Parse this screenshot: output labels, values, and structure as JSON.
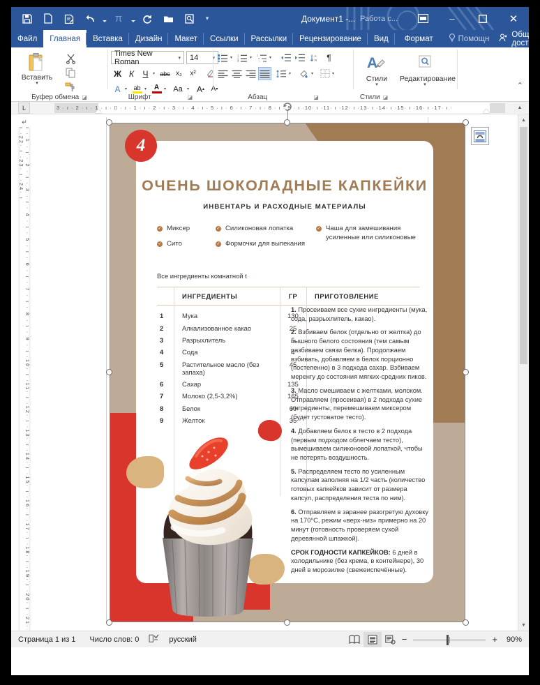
{
  "titlebar": {
    "document_title": "Документ1 -...",
    "context_title": "Работа с...",
    "quick_access": [
      {
        "name": "save-icon",
        "label": "Сохранить"
      },
      {
        "name": "new-document-icon",
        "label": "Создать"
      },
      {
        "name": "quick-print-icon",
        "label": "Быстрая печать"
      },
      {
        "name": "undo-icon",
        "label": "Отменить"
      },
      {
        "name": "equation-icon",
        "label": "Формула"
      },
      {
        "name": "redo-icon",
        "label": "Вернуть"
      },
      {
        "name": "open-icon",
        "label": "Открыть"
      },
      {
        "name": "print-preview-icon",
        "label": "Предварительный просмотр"
      }
    ],
    "customize_label": "⌄",
    "ribbon_display_label": "⊞",
    "minimize_label": "–",
    "maximize_label": "❐",
    "close_label": "✕"
  },
  "tabs": [
    {
      "label": "Файл",
      "active": false
    },
    {
      "label": "Главная",
      "active": true
    },
    {
      "label": "Вставка",
      "active": false
    },
    {
      "label": "Дизайн",
      "active": false
    },
    {
      "label": "Макет",
      "active": false
    },
    {
      "label": "Ссылки",
      "active": false
    },
    {
      "label": "Рассылки",
      "active": false
    },
    {
      "label": "Рецензирование",
      "active": false
    },
    {
      "label": "Вид",
      "active": false
    },
    {
      "label": "Формат",
      "active": false
    }
  ],
  "tab_right": {
    "help_label": "Помощн",
    "share_label": "Общий доступ"
  },
  "ribbon": {
    "groups": [
      {
        "name": "clipboard",
        "label": "Буфер обмена"
      },
      {
        "name": "font",
        "label": "Шрифт"
      },
      {
        "name": "paragraph",
        "label": "Абзац"
      },
      {
        "name": "styles",
        "label": "Стили"
      }
    ],
    "paste_label": "Вставить",
    "font_name": "Times New Roman",
    "font_size": "14",
    "bold_label": "Ж",
    "italic_label": "К",
    "underline_label": "Ч",
    "strike_label": "abc",
    "subscript_label": "x₂",
    "superscript_label": "x²",
    "clearformat_label": "✑",
    "texteffect_label": "A",
    "highlight_label": "ab",
    "fontcolor_label": "A",
    "changecase_label": "Aa",
    "grow_label": "A",
    "shrink_label": "A",
    "pilcrow_label": "¶",
    "styles_label": "Стили",
    "editing_label": "Редактирование",
    "collapse_label": "⌃"
  },
  "ruler": {
    "tab_selector": "L",
    "h_marks": "3 · ı · 2 · ı · 1 · ı · ⌷ · ı · 1 · ı · 2 · ı · 3 · ı · 4 · ı · 5 · ı · 6 · ı · 7 · ı · 8 · ı · 9 · ı ·10· ı ·11· ı ·12· ı ·13· ı ·14· ı ·15· ı ·16· ı ·17· ı ·",
    "v_marks": "ı · 1 · ı · 2 · ı · 3 · ı · 4 · ı · 5 · ı · 6 · ı · 7 · ı · 8 · ı · 9 · ı ·10· ı ·11· ı ·12· ı ·13· ı ·14· ı ·15· ı ·16· ı ·17· ı ·18· ı ·19· ı ·20· ı ·21· ı ·22· ı ·23· ı ·24· ı"
  },
  "recipe": {
    "badge_number": "4",
    "title": "ОЧЕНЬ ШОКОЛАДНЫЕ КАПКЕЙКИ",
    "subtitle": "ИНВЕНТАРЬ И РАСХОДНЫЕ МАТЕРИАЛЫ",
    "inventory": [
      "Миксер",
      "Сито",
      "Силиконовая лопатка",
      "Формочки для выпекания",
      "Чаша для замешивания\nусиленные или силиконовые"
    ],
    "room_temp_note": "Все ингредиенты комнатной t",
    "table": {
      "headers": [
        "",
        "ИНГРЕДИЕНТЫ",
        "ГР",
        "ПРИГОТОВЛЕНИЕ"
      ],
      "rows": [
        {
          "no": "1",
          "ingredient": "Мука",
          "gr": "130"
        },
        {
          "no": "2",
          "ingredient": "Алкализованное какао",
          "gr": "25"
        },
        {
          "no": "3",
          "ingredient": "Разрыхлитель",
          "gr": "5"
        },
        {
          "no": "4",
          "ingredient": "Сода",
          "gr": "4"
        },
        {
          "no": "5",
          "ingredient": "Растительное масло (без запаха)",
          "gr": "45"
        },
        {
          "no": "6",
          "ingredient": "Сахар",
          "gr": "135"
        },
        {
          "no": "7",
          "ingredient": "Молоко (2,5-3,2%)",
          "gr": "165"
        },
        {
          "no": "8",
          "ingredient": "Белок",
          "gr": "60"
        },
        {
          "no": "9",
          "ingredient": "Желток",
          "gr": "35"
        }
      ]
    },
    "steps": [
      {
        "num": "1.",
        "text": "Просеиваем все сухие ингредиенты (мука, сода, разрыхлитель, какао)."
      },
      {
        "num": "2.",
        "text": "Взбиваем белок (отдельно от желтка) до пышного белого состояния (тем самым разбиваем связи белка). Продолжаем взбивать, добавляем в белок порционно (постепенно) в 3 подхода сахар. Взбиваем меренгу до состояния мягких-средних пиков."
      },
      {
        "num": "3.",
        "text": "Масло смешиваем с желтками, молоком. Отправляем (просеивая) в 2 подхода сухие ингредиенты, перемешиваем миксером (будет густоватое тесто)."
      },
      {
        "num": "4.",
        "text": "Добавляем белок в тесто в 2 подхода (первым подходом облегчаем тесто), вымешиваем силиконовой лопаткой, чтобы не потерять воздушность."
      },
      {
        "num": "5.",
        "text": "Распределяем тесто по усиленным капсулам заполняя на 1/2 часть (количество готовых капкейков зависит от размера капсул, распределения теста по ним)."
      },
      {
        "num": "6.",
        "text": "Отправляем в заранее разогретую духовку на 170°С, режим «верх-низ» примерно на 20 минут (готовность проверяем сухой деревянной шпажкой)."
      }
    ],
    "shelf_life_label": "СРОК ГОДНОСТИ КАПКЕЙКОВ:",
    "shelf_life_text": " 6 дней в холодильнике (без крема, в контейнере), 30 дней в морозилке (свежеиспечённые).",
    "colors": {
      "brown": "#a07b54",
      "taupe": "#bdab98",
      "red": "#d8362c",
      "gold": "#d9b47e",
      "title": "#a07b54"
    }
  },
  "statusbar": {
    "page": "Страница 1 из 1",
    "words": "Число слов: 0",
    "proofing_icon": "spellcheck-icon",
    "language": "русский",
    "view_read_icon": "read-mode-icon",
    "view_print_icon": "print-layout-icon",
    "view_web_icon": "web-layout-icon",
    "zoom_out": "−",
    "zoom_in": "+",
    "zoom_level": "90%"
  }
}
